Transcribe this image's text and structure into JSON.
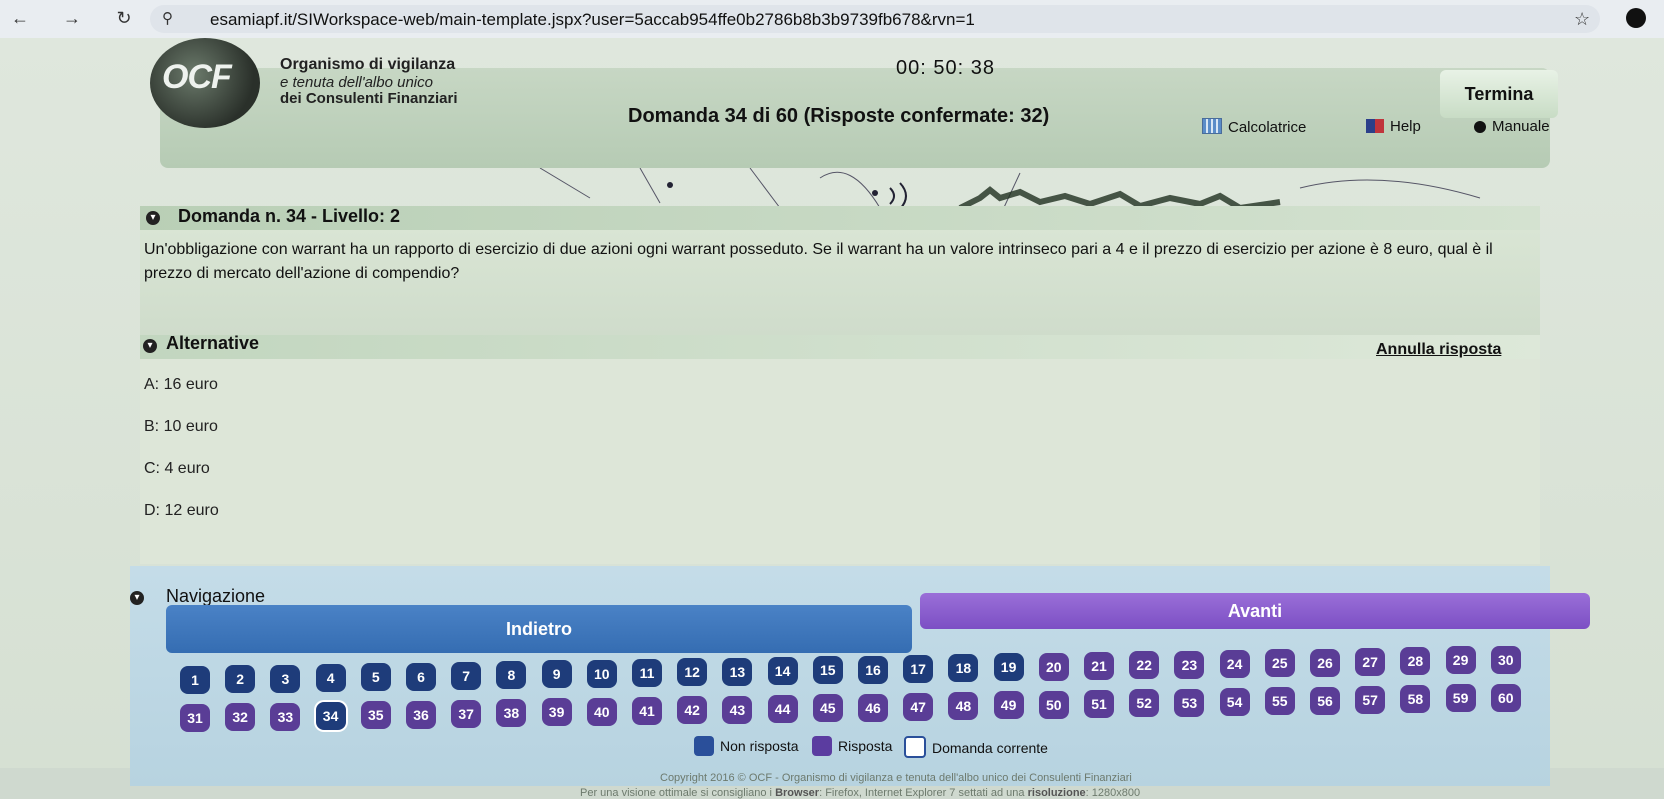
{
  "browser": {
    "url": "esamiapf.it/SIWorkspace-web/main-template.jspx?user=5accab954ffe0b2786b8b3b9739fb678&rvn=1"
  },
  "header": {
    "logo_text": "OCF",
    "org_line1": "Organismo di vigilanza",
    "org_line2": "e tenuta dell'albo unico",
    "org_line3": "dei Consulenti Finanziari",
    "timer": "00: 50: 38",
    "termina": "Termina",
    "domanda_title": "Domanda 34 di 60 (Risposte confermate: 32)",
    "tools": {
      "calcolatrice": "Calcolatrice",
      "help": "Help",
      "manuale": "Manuale"
    }
  },
  "question": {
    "header": "Domanda n. 34 - Livello: 2",
    "text": "Un'obbligazione con warrant ha un rapporto di esercizio di due azioni ogni warrant posseduto. Se il warrant ha un valore intrinseco pari a 4 e il prezzo di esercizio per azione è 8 euro, qual è il prezzo di mercato dell'azione di compendio?"
  },
  "alternatives": {
    "title": "Alternative",
    "annulla": "Annulla risposta",
    "items": [
      {
        "key": "A:",
        "text": "16 euro"
      },
      {
        "key": "B:",
        "text": "10 euro"
      },
      {
        "key": "C:",
        "text": "4 euro"
      },
      {
        "key": "D:",
        "text": "12 euro"
      }
    ]
  },
  "navigation": {
    "title": "Navigazione",
    "indietro": "Indietro",
    "avanti": "Avanti",
    "current": 34,
    "row1": [
      "1",
      "2",
      "3",
      "4",
      "5",
      "6",
      "7",
      "8",
      "9",
      "10",
      "11",
      "12",
      "13",
      "14",
      "15",
      "16",
      "17",
      "18",
      "19",
      "20",
      "21",
      "22",
      "23",
      "24",
      "25",
      "26",
      "27",
      "28",
      "29",
      "30"
    ],
    "row2": [
      "31",
      "32",
      "33",
      "34",
      "35",
      "36",
      "37",
      "38",
      "39",
      "40",
      "41",
      "42",
      "43",
      "44",
      "45",
      "46",
      "47",
      "48",
      "49",
      "50",
      "51",
      "52",
      "53",
      "54",
      "55",
      "56",
      "57",
      "58",
      "59",
      "60"
    ],
    "legend": {
      "non_risposta": "Non risposta",
      "risposta": "Risposta",
      "corrente": "Domanda corrente"
    }
  },
  "footer": {
    "copyright": "Copyright 2016 © OCF - Organismo di vigilanza e tenuta dell'albo unico dei Consulenti Finanziari",
    "note_prefix": "Per una visione ottimale si consigliano i",
    "note_browser_label": "Browser",
    "note_browser": ": Firefox, Internet Explorer 7 settati ad una",
    "note_res_label": "risoluzione",
    "note_res": ": 1280x800"
  },
  "colors": {
    "non_risposta": "#2a4f9a",
    "risposta": "#5b3ca0",
    "indietro": "#4a82c6",
    "avanti": "#8a5fd0"
  }
}
